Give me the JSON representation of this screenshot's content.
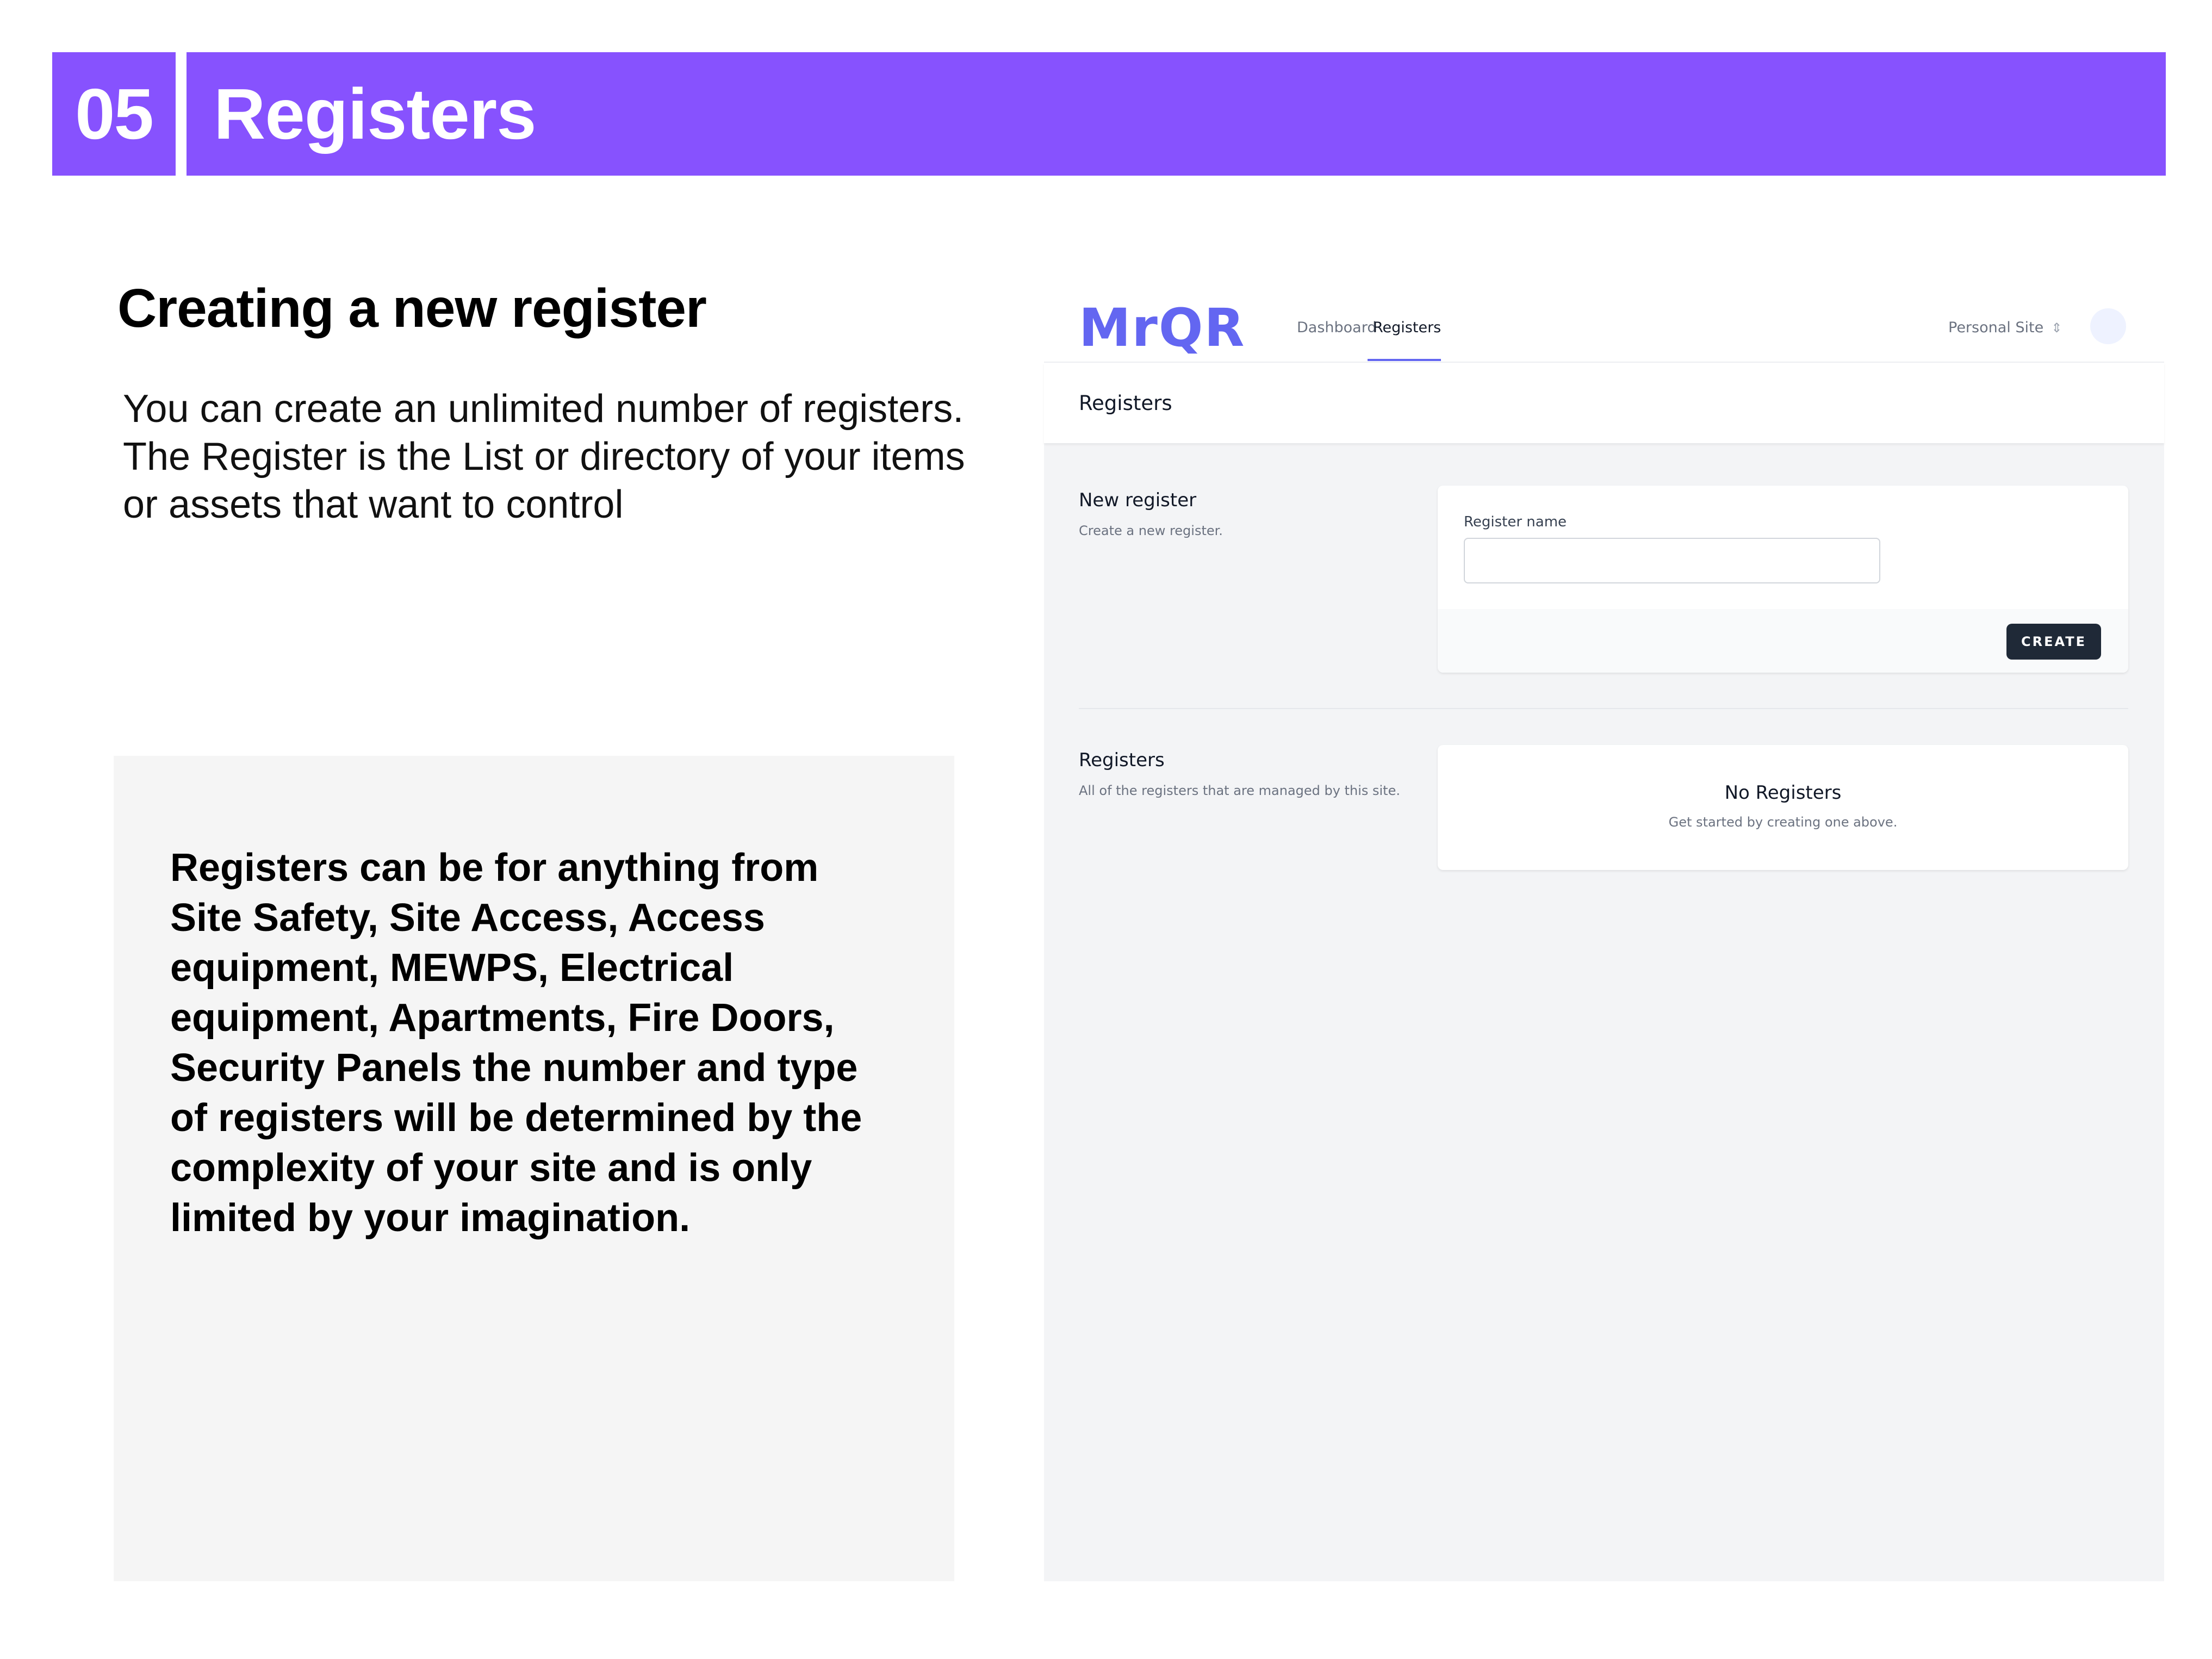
{
  "header": {
    "number": "05",
    "title": "Registers"
  },
  "left": {
    "heading": "Creating a new register",
    "intro": "You can create an unlimited number of registers. The Register is the List or directory of your items or assets that want to control",
    "info": "Registers can be for anything from Site Safety, Site Access, Access equipment, MEWPS, Electrical equipment, Apartments, Fire Doors, Security Panels the number and type of registers will be determined by the complexity of your site and is only limited by your imagination."
  },
  "app": {
    "logo": "MrQR",
    "nav": {
      "dashboard": "Dashboard",
      "registers": "Registers",
      "active": "registers"
    },
    "site_selector": "Personal Site",
    "page_title": "Registers",
    "new_register": {
      "title": "New register",
      "subtitle": "Create a new register.",
      "field_label": "Register name",
      "field_value": "",
      "create_label": "CREATE"
    },
    "registers_section": {
      "title": "Registers",
      "subtitle": "All of the registers that are managed by this site.",
      "empty_title": "No Registers",
      "empty_subtitle": "Get started by creating one above."
    }
  },
  "colors": {
    "brand_purple": "#8752fe",
    "accent_indigo": "#6366f1",
    "button_dark": "#1f2937",
    "panel_grey": "#f5f5f5"
  }
}
